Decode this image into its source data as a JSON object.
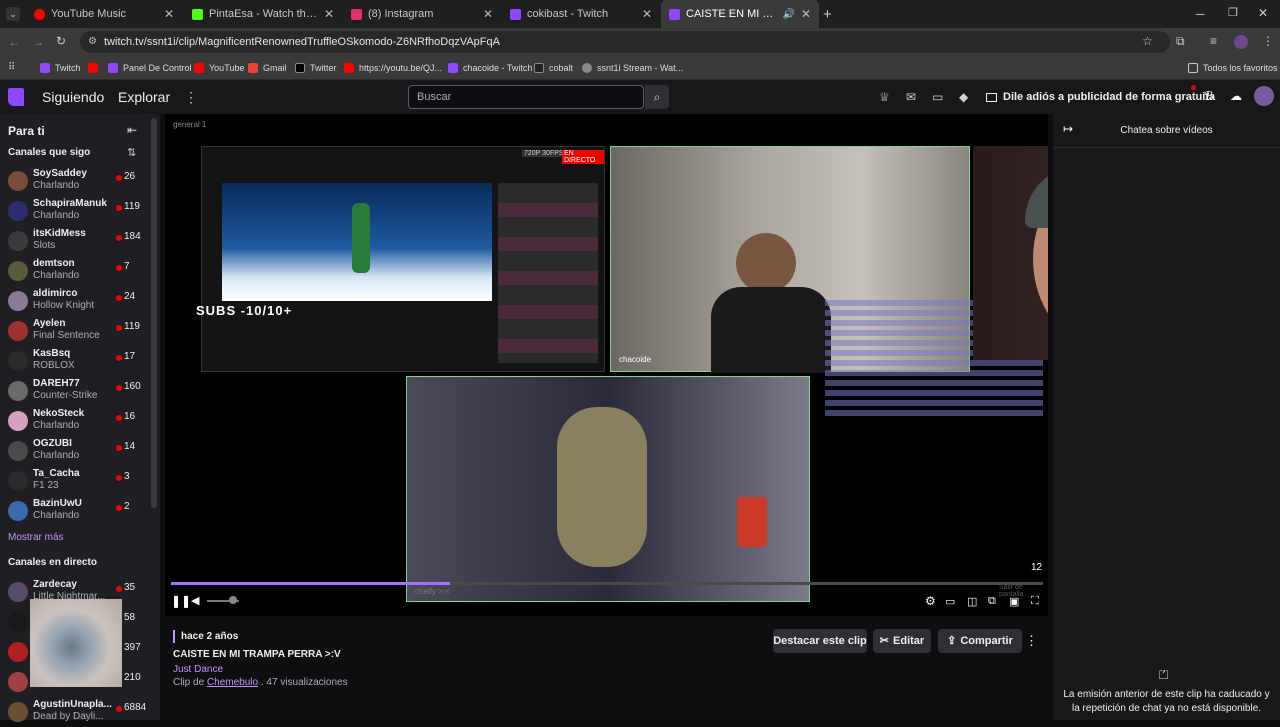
{
  "browser": {
    "tabs": [
      {
        "label": "YouTube Music",
        "color": "#ff0000"
      },
      {
        "label": "PintaEsa - Watch the VOD on K",
        "color": "#53fc18"
      },
      {
        "label": "(8) Instagram",
        "color": "#e1306c"
      },
      {
        "label": "cokibast - Twitch",
        "color": "#9146ff"
      },
      {
        "label": "CAISTE EN MI TRAMPA PERR",
        "color": "#9146ff"
      }
    ],
    "url": "twitch.tv/ssnt1i/clip/MagnificentRenownedTruffleOSkomodo-Z6NRfhoDqzVApFqA",
    "bookmarks": [
      {
        "label": "Twitch",
        "color": "#9146ff"
      },
      {
        "label": "",
        "color": "#ff0000"
      },
      {
        "label": "Panel De Control",
        "color": "#9146ff"
      },
      {
        "label": "YouTube",
        "color": "#ff0000"
      },
      {
        "label": "Gmail",
        "color": "#ea4335"
      },
      {
        "label": "Twitter",
        "color": "#000000"
      },
      {
        "label": "https://youtu.be/QJ...",
        "color": "#ff0000"
      },
      {
        "label": "chacoide - Twitch",
        "color": "#9146ff"
      },
      {
        "label": "cobalt",
        "color": "#222222"
      },
      {
        "label": "ssnt1i Stream - Wat...",
        "color": "#888888"
      }
    ],
    "all_favorites": "Todos los favoritos"
  },
  "nav": {
    "following": "Siguiendo",
    "explore": "Explorar",
    "search_placeholder": "Buscar",
    "ad_free": "Dile adiós a publicidad de forma gratuita"
  },
  "sidebar": {
    "for_you": "Para ti",
    "followed_header": "Canales que sigo",
    "channels": [
      {
        "name": "SoySaddey",
        "game": "Charlando",
        "viewers": "26",
        "color": "#7a4b3a"
      },
      {
        "name": "SchapiraManuk",
        "game": "Charlando",
        "viewers": "119",
        "color": "#2d2d6e"
      },
      {
        "name": "itsKidMess",
        "game": "Slots",
        "viewers": "184",
        "color": "#3b3b3b"
      },
      {
        "name": "demtson",
        "game": "Charlando",
        "viewers": "7",
        "color": "#5a5a3a"
      },
      {
        "name": "aldimirco",
        "game": "Hollow Knight",
        "viewers": "24",
        "color": "#8a7a9a"
      },
      {
        "name": "Ayelen",
        "game": "Final Sentence",
        "viewers": "119",
        "color": "#a03030"
      },
      {
        "name": "KasBsq",
        "game": "ROBLOX",
        "viewers": "17",
        "color": "#2a2a2a"
      },
      {
        "name": "DAREH77",
        "game": "Counter-Strike",
        "viewers": "160",
        "color": "#6a6a6a"
      },
      {
        "name": "NekoSteck",
        "game": "Charlando",
        "viewers": "16",
        "color": "#d8a0c0"
      },
      {
        "name": "OGZUBI",
        "game": "Charlando",
        "viewers": "14",
        "color": "#4a4a4a"
      },
      {
        "name": "Ta_Cacha",
        "game": "F1 23",
        "viewers": "3",
        "color": "#2a2a2a"
      },
      {
        "name": "BazinUwU",
        "game": "Charlando",
        "viewers": "2",
        "color": "#3a6ab0"
      }
    ],
    "show_more": "Mostrar más",
    "live_header": "Canales en directo",
    "live_channels": [
      {
        "name": "Zardecay",
        "game": "Little Nightmar...",
        "viewers": "35",
        "color": "#5a4a6a"
      },
      {
        "name": "",
        "game": "",
        "viewers": "58",
        "color": "#1a1a1a"
      },
      {
        "name": "",
        "game": "",
        "viewers": "397",
        "color": "#b02020"
      },
      {
        "name": "",
        "game": "",
        "viewers": "210",
        "color": "#a04040"
      },
      {
        "name": "AgustinUnapla...",
        "game": "Dead by Dayli...",
        "viewers": "6884",
        "color": "#6a5030"
      }
    ]
  },
  "player": {
    "top_label": "general 1",
    "stream_label": "720P 30FPS",
    "live_badge": "EN DIRECTO",
    "subs_text": "SUBS -10/10+",
    "cam_name": "chacoide",
    "corner_name": "cheify >:<",
    "counter": "12",
    "exit_fullscreen": "Salir de pantalla",
    "progress": 0.32
  },
  "clip": {
    "time_ago": "hace 2 años",
    "title": "CAISTE EN MI TRAMPA PERRA >:V",
    "game": "Just Dance",
    "clipped_by_prefix": "Clip de",
    "clipper": "Chemebulo",
    "views": ". 47 visualizaciones",
    "feature_button": "Destacar este clip",
    "edit_button": "Editar",
    "share_button": "Compartir"
  },
  "chat": {
    "header": "Chatea sobre vídeos",
    "unavailable": "La emisión anterior de este clip ha caducado y la repetición de chat ya no está disponible."
  }
}
